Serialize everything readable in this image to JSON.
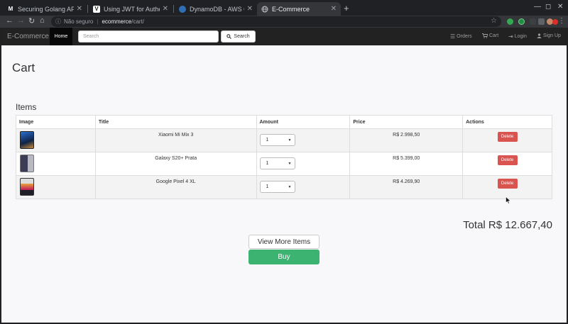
{
  "browser": {
    "tabs": [
      {
        "title": "Securing Golang API usin",
        "favicon": "M",
        "favicon_color": "#ffffff",
        "favicon_bg": "#202124"
      },
      {
        "title": "Using JWT for Authenticat",
        "favicon": "V",
        "favicon_color": "#202124",
        "favicon_bg": "#ffffff"
      },
      {
        "title": "DynamoDB - AWS Console",
        "favicon": "",
        "favicon_color": "#ffffff",
        "favicon_bg": "#2f6fb5"
      },
      {
        "title": "E-Commerce",
        "favicon": "",
        "favicon_color": "#ffffff",
        "favicon_bg": "#5f6368"
      }
    ],
    "address": {
      "insecure_label": "Não seguro",
      "host": "ecommerce",
      "path": "/cart/"
    }
  },
  "nav": {
    "brand": "E-Commerce",
    "home": "Home",
    "search_placeholder": "Search",
    "search_button": "Search",
    "orders": "Orders",
    "cart": "Cart",
    "login": "Login",
    "signup": "Sign Up"
  },
  "page": {
    "title": "Cart",
    "items_heading": "Items"
  },
  "table": {
    "headers": {
      "image": "Image",
      "title": "Title",
      "amount": "Amount",
      "price": "Price",
      "actions": "Actions"
    },
    "rows": [
      {
        "title": "Xiaomi Mi Mix 3",
        "amount": "1",
        "price": "R$ 2.998,50",
        "action": "Delete",
        "phone_color": "#1a3a6b"
      },
      {
        "title": "Galaxy S20+ Prata",
        "amount": "1",
        "price": "R$ 5.399,00",
        "action": "Delete",
        "phone_color": "#8a8a95"
      },
      {
        "title": "Google Pixel 4 XL",
        "amount": "1",
        "price": "R$ 4.269,90",
        "action": "Delete",
        "phone_color": "#2d2d35"
      }
    ]
  },
  "summary": {
    "total": "Total R$ 12.667,40",
    "view_more": "View More Items",
    "buy": "Buy"
  },
  "colors": {
    "navbar": "#222222",
    "delete": "#d9534f",
    "buy": "#3cb371"
  }
}
